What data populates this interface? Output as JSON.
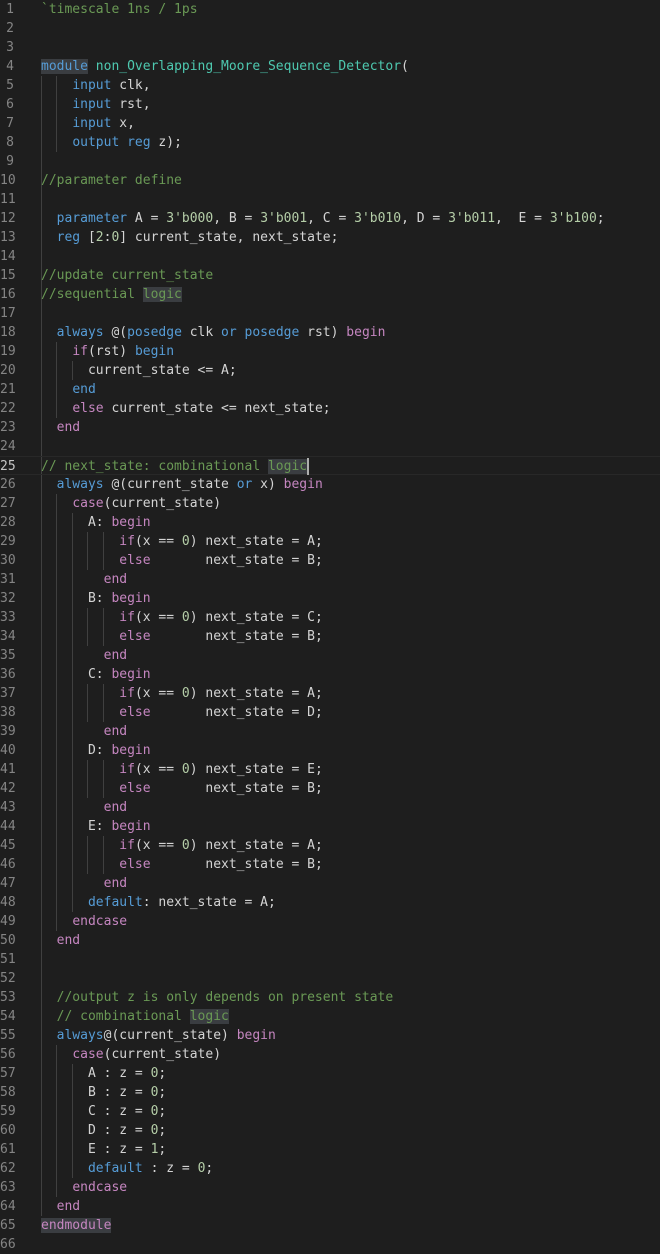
{
  "editor": {
    "language": "verilog",
    "colors": {
      "background": "#1e1e1e",
      "keyword": "#569cd6",
      "control": "#c586c0",
      "comment": "#6a9955",
      "number": "#b5cea8",
      "text": "#d4d4d4",
      "type": "#4ec9b0",
      "line_number": "#858585"
    },
    "active_line": 25,
    "lines": [
      {
        "n": "1",
        "tokens": [
          [
            "cmt",
            "`timescale 1ns / 1ps"
          ]
        ]
      },
      {
        "n": "2",
        "tokens": []
      },
      {
        "n": "3",
        "tokens": []
      },
      {
        "n": "4",
        "tokens": [
          [
            "kw hl",
            "module"
          ],
          [
            "plain",
            " "
          ],
          [
            "modname",
            "non_Overlapping_Moore_Sequence_Detector"
          ],
          [
            "plain",
            "("
          ]
        ]
      },
      {
        "n": "5",
        "tokens": [
          [
            "plain",
            "    "
          ],
          [
            "kw",
            "input"
          ],
          [
            "plain",
            " clk,"
          ]
        ]
      },
      {
        "n": "6",
        "tokens": [
          [
            "plain",
            "    "
          ],
          [
            "kw",
            "input"
          ],
          [
            "plain",
            " rst,"
          ]
        ]
      },
      {
        "n": "7",
        "tokens": [
          [
            "plain",
            "    "
          ],
          [
            "kw",
            "input"
          ],
          [
            "plain",
            " x,"
          ]
        ]
      },
      {
        "n": "8",
        "tokens": [
          [
            "plain",
            "    "
          ],
          [
            "kw",
            "output"
          ],
          [
            "plain",
            " "
          ],
          [
            "kw",
            "reg"
          ],
          [
            "plain",
            " z);"
          ]
        ]
      },
      {
        "n": "9",
        "tokens": []
      },
      {
        "n": "10",
        "tokens": [
          [
            "cmt",
            "//parameter define"
          ]
        ]
      },
      {
        "n": "11",
        "tokens": []
      },
      {
        "n": "12",
        "tokens": [
          [
            "plain",
            "  "
          ],
          [
            "kw",
            "parameter"
          ],
          [
            "plain",
            " A = "
          ],
          [
            "num",
            "3'b000"
          ],
          [
            "plain",
            ", B = "
          ],
          [
            "num",
            "3'b001"
          ],
          [
            "plain",
            ", C = "
          ],
          [
            "num",
            "3'b010"
          ],
          [
            "plain",
            ", D = "
          ],
          [
            "num",
            "3'b011"
          ],
          [
            "plain",
            ",  E = "
          ],
          [
            "num",
            "3'b100"
          ],
          [
            "plain",
            ";"
          ]
        ]
      },
      {
        "n": "13",
        "tokens": [
          [
            "plain",
            "  "
          ],
          [
            "kw",
            "reg"
          ],
          [
            "plain",
            " ["
          ],
          [
            "num",
            "2"
          ],
          [
            "plain",
            ":"
          ],
          [
            "num",
            "0"
          ],
          [
            "plain",
            "] current_state, next_state;"
          ]
        ]
      },
      {
        "n": "14",
        "tokens": []
      },
      {
        "n": "15",
        "tokens": [
          [
            "cmt",
            "//update current_state"
          ]
        ]
      },
      {
        "n": "16",
        "tokens": [
          [
            "cmt",
            "//sequential "
          ],
          [
            "cmt hl",
            "logic"
          ]
        ]
      },
      {
        "n": "17",
        "tokens": []
      },
      {
        "n": "18",
        "tokens": [
          [
            "plain",
            "  "
          ],
          [
            "kw",
            "always"
          ],
          [
            "plain",
            " @("
          ],
          [
            "kw",
            "posedge"
          ],
          [
            "plain",
            " clk "
          ],
          [
            "kw",
            "or"
          ],
          [
            "plain",
            " "
          ],
          [
            "kw",
            "posedge"
          ],
          [
            "plain",
            " rst) "
          ],
          [
            "ctrl",
            "begin"
          ]
        ]
      },
      {
        "n": "19",
        "tokens": [
          [
            "plain",
            "    "
          ],
          [
            "ctrl",
            "if"
          ],
          [
            "plain",
            "(rst) "
          ],
          [
            "kw",
            "begin"
          ]
        ]
      },
      {
        "n": "20",
        "tokens": [
          [
            "plain",
            "      current_state <= A;"
          ]
        ]
      },
      {
        "n": "21",
        "tokens": [
          [
            "plain",
            "    "
          ],
          [
            "kw",
            "end"
          ]
        ]
      },
      {
        "n": "22",
        "tokens": [
          [
            "plain",
            "    "
          ],
          [
            "ctrl",
            "else"
          ],
          [
            "plain",
            " current_state <= next_state;"
          ]
        ]
      },
      {
        "n": "23",
        "tokens": [
          [
            "plain",
            "  "
          ],
          [
            "ctrl",
            "end"
          ]
        ]
      },
      {
        "n": "24",
        "tokens": []
      },
      {
        "n": "25",
        "tokens": [
          [
            "cmt",
            "// next_state: combinational "
          ],
          [
            "cmt hl",
            "logic"
          ],
          [
            "cursor",
            ""
          ]
        ]
      },
      {
        "n": "26",
        "tokens": [
          [
            "plain",
            "  "
          ],
          [
            "kw",
            "always"
          ],
          [
            "plain",
            " @(current_state "
          ],
          [
            "kw",
            "or"
          ],
          [
            "plain",
            " x) "
          ],
          [
            "ctrl",
            "begin"
          ]
        ]
      },
      {
        "n": "27",
        "tokens": [
          [
            "plain",
            "    "
          ],
          [
            "ctrl",
            "case"
          ],
          [
            "plain",
            "(current_state)"
          ]
        ]
      },
      {
        "n": "28",
        "tokens": [
          [
            "plain",
            "      A: "
          ],
          [
            "ctrl",
            "begin"
          ]
        ]
      },
      {
        "n": "29",
        "tokens": [
          [
            "plain",
            "          "
          ],
          [
            "ctrl",
            "if"
          ],
          [
            "plain",
            "(x == "
          ],
          [
            "num",
            "0"
          ],
          [
            "plain",
            ") next_state = A;"
          ]
        ]
      },
      {
        "n": "30",
        "tokens": [
          [
            "plain",
            "          "
          ],
          [
            "ctrl",
            "else"
          ],
          [
            "plain",
            "       next_state = B;"
          ]
        ]
      },
      {
        "n": "31",
        "tokens": [
          [
            "plain",
            "        "
          ],
          [
            "ctrl",
            "end"
          ]
        ]
      },
      {
        "n": "32",
        "tokens": [
          [
            "plain",
            "      B: "
          ],
          [
            "ctrl",
            "begin"
          ]
        ]
      },
      {
        "n": "33",
        "tokens": [
          [
            "plain",
            "          "
          ],
          [
            "ctrl",
            "if"
          ],
          [
            "plain",
            "(x == "
          ],
          [
            "num",
            "0"
          ],
          [
            "plain",
            ") next_state = C;"
          ]
        ]
      },
      {
        "n": "34",
        "tokens": [
          [
            "plain",
            "          "
          ],
          [
            "ctrl",
            "else"
          ],
          [
            "plain",
            "       next_state = B;"
          ]
        ]
      },
      {
        "n": "35",
        "tokens": [
          [
            "plain",
            "        "
          ],
          [
            "ctrl",
            "end"
          ]
        ]
      },
      {
        "n": "36",
        "tokens": [
          [
            "plain",
            "      C: "
          ],
          [
            "ctrl",
            "begin"
          ]
        ]
      },
      {
        "n": "37",
        "tokens": [
          [
            "plain",
            "          "
          ],
          [
            "ctrl",
            "if"
          ],
          [
            "plain",
            "(x == "
          ],
          [
            "num",
            "0"
          ],
          [
            "plain",
            ") next_state = A;"
          ]
        ]
      },
      {
        "n": "38",
        "tokens": [
          [
            "plain",
            "          "
          ],
          [
            "ctrl",
            "else"
          ],
          [
            "plain",
            "       next_state = D;"
          ]
        ]
      },
      {
        "n": "39",
        "tokens": [
          [
            "plain",
            "        "
          ],
          [
            "ctrl",
            "end"
          ]
        ]
      },
      {
        "n": "40",
        "tokens": [
          [
            "plain",
            "      D: "
          ],
          [
            "ctrl",
            "begin"
          ]
        ]
      },
      {
        "n": "41",
        "tokens": [
          [
            "plain",
            "          "
          ],
          [
            "ctrl",
            "if"
          ],
          [
            "plain",
            "(x == "
          ],
          [
            "num",
            "0"
          ],
          [
            "plain",
            ") next_state = E;"
          ]
        ]
      },
      {
        "n": "42",
        "tokens": [
          [
            "plain",
            "          "
          ],
          [
            "ctrl",
            "else"
          ],
          [
            "plain",
            "       next_state = B;"
          ]
        ]
      },
      {
        "n": "43",
        "tokens": [
          [
            "plain",
            "        "
          ],
          [
            "ctrl",
            "end"
          ]
        ]
      },
      {
        "n": "44",
        "tokens": [
          [
            "plain",
            "      E: "
          ],
          [
            "ctrl",
            "begin"
          ]
        ]
      },
      {
        "n": "45",
        "tokens": [
          [
            "plain",
            "          "
          ],
          [
            "ctrl",
            "if"
          ],
          [
            "plain",
            "(x == "
          ],
          [
            "num",
            "0"
          ],
          [
            "plain",
            ") next_state = A;"
          ]
        ]
      },
      {
        "n": "46",
        "tokens": [
          [
            "plain",
            "          "
          ],
          [
            "ctrl",
            "else"
          ],
          [
            "plain",
            "       next_state = B;"
          ]
        ]
      },
      {
        "n": "47",
        "tokens": [
          [
            "plain",
            "        "
          ],
          [
            "ctrl",
            "end"
          ]
        ]
      },
      {
        "n": "48",
        "tokens": [
          [
            "plain",
            "      "
          ],
          [
            "kw",
            "default"
          ],
          [
            "plain",
            ": next_state = A;"
          ]
        ]
      },
      {
        "n": "49",
        "tokens": [
          [
            "plain",
            "    "
          ],
          [
            "ctrl",
            "endcase"
          ]
        ]
      },
      {
        "n": "50",
        "tokens": [
          [
            "plain",
            "  "
          ],
          [
            "ctrl",
            "end"
          ]
        ]
      },
      {
        "n": "51",
        "tokens": []
      },
      {
        "n": "52",
        "tokens": []
      },
      {
        "n": "53",
        "tokens": [
          [
            "plain",
            "  "
          ],
          [
            "cmt",
            "//output z is only depends on present state"
          ]
        ]
      },
      {
        "n": "54",
        "tokens": [
          [
            "plain",
            "  "
          ],
          [
            "cmt",
            "// combinational "
          ],
          [
            "cmt hl",
            "logic"
          ]
        ]
      },
      {
        "n": "55",
        "tokens": [
          [
            "plain",
            "  "
          ],
          [
            "kw",
            "always"
          ],
          [
            "plain",
            "@(current_state) "
          ],
          [
            "ctrl",
            "begin"
          ]
        ]
      },
      {
        "n": "56",
        "tokens": [
          [
            "plain",
            "    "
          ],
          [
            "ctrl",
            "case"
          ],
          [
            "plain",
            "(current_state)"
          ]
        ]
      },
      {
        "n": "57",
        "tokens": [
          [
            "plain",
            "      A : z = "
          ],
          [
            "num",
            "0"
          ],
          [
            "plain",
            ";"
          ]
        ]
      },
      {
        "n": "58",
        "tokens": [
          [
            "plain",
            "      B : z = "
          ],
          [
            "num",
            "0"
          ],
          [
            "plain",
            ";"
          ]
        ]
      },
      {
        "n": "59",
        "tokens": [
          [
            "plain",
            "      C : z = "
          ],
          [
            "num",
            "0"
          ],
          [
            "plain",
            ";"
          ]
        ]
      },
      {
        "n": "60",
        "tokens": [
          [
            "plain",
            "      D : z = "
          ],
          [
            "num",
            "0"
          ],
          [
            "plain",
            ";"
          ]
        ]
      },
      {
        "n": "61",
        "tokens": [
          [
            "plain",
            "      E : z = "
          ],
          [
            "num",
            "1"
          ],
          [
            "plain",
            ";"
          ]
        ]
      },
      {
        "n": "62",
        "tokens": [
          [
            "plain",
            "      "
          ],
          [
            "kw",
            "default"
          ],
          [
            "plain",
            " : z = "
          ],
          [
            "num",
            "0"
          ],
          [
            "plain",
            ";"
          ]
        ]
      },
      {
        "n": "63",
        "tokens": [
          [
            "plain",
            "    "
          ],
          [
            "ctrl",
            "endcase"
          ]
        ]
      },
      {
        "n": "64",
        "tokens": [
          [
            "plain",
            "  "
          ],
          [
            "ctrl",
            "end"
          ]
        ]
      },
      {
        "n": "65",
        "tokens": [
          [
            "ctrl hl",
            "endmodule"
          ]
        ]
      },
      {
        "n": "66",
        "tokens": []
      }
    ]
  }
}
